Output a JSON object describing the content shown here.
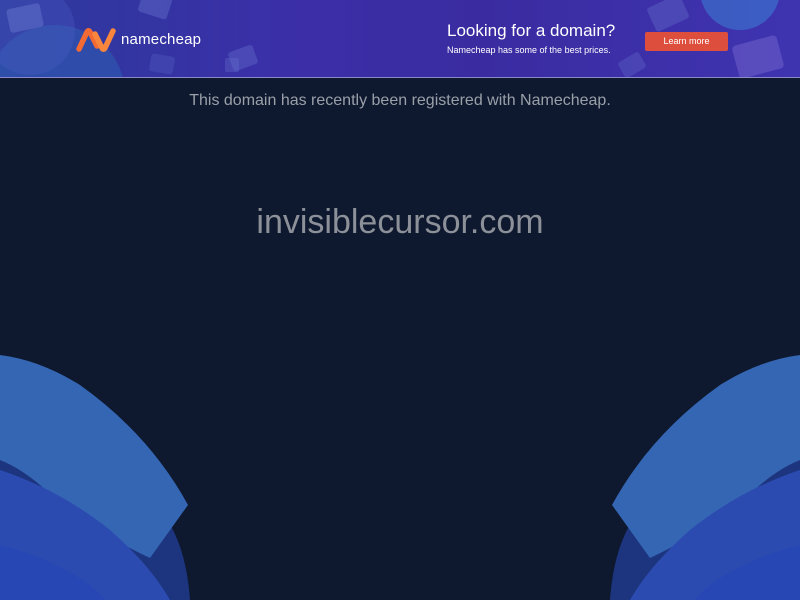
{
  "banner": {
    "logo_text": "namecheap",
    "promo_title": "Looking for a domain?",
    "promo_subtitle": "Namecheap has some of the best prices.",
    "cta_label": "Learn more",
    "colors": {
      "background_start": "#2c3a9c",
      "background_end": "#3f34b0",
      "cta": "#de4e3c",
      "logo_orange": "#f46a35"
    }
  },
  "main": {
    "registered_notice": "This domain has recently been registered with Namecheap.",
    "domain": "invisiblecursor.com",
    "colors": {
      "background": "#0e182e",
      "wave_light": "#3566b4",
      "wave_dark": "#2c4bb0"
    }
  }
}
